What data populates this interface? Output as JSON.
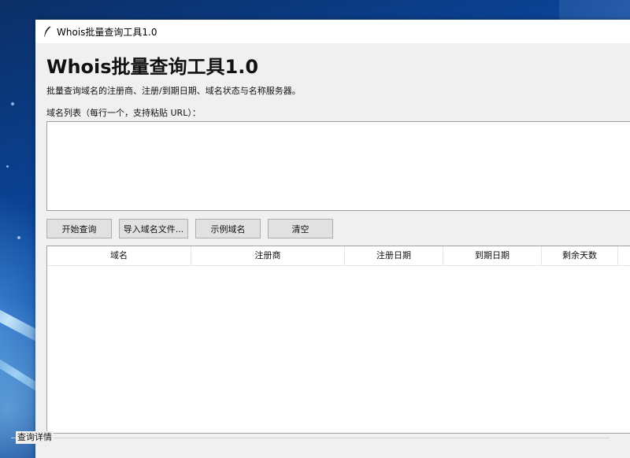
{
  "window": {
    "title": "Whois批量查询工具1.0",
    "icon": "feather-icon"
  },
  "header": {
    "title": "Whois批量查询工具1.0",
    "subtitle": "批量查询域名的注册商、注册/到期日期、域名状态与名称服务器。"
  },
  "input": {
    "label": "域名列表（每行一个，支持粘贴 URL）：",
    "value": ""
  },
  "toolbar": {
    "start_label": "开始查询",
    "import_label": "导入域名文件...",
    "sample_label": "示例域名",
    "clear_label": "清空"
  },
  "table": {
    "columns": [
      "域名",
      "注册商",
      "注册日期",
      "到期日期",
      "剩余天数",
      ""
    ],
    "rows": []
  },
  "details": {
    "label": "查询详情"
  },
  "colors": {
    "window_bg": "#f0f0f0",
    "titlebar_bg": "#ffffff",
    "button_bg": "#e1e1e1",
    "desktop_bg": "#0b4aa8"
  }
}
